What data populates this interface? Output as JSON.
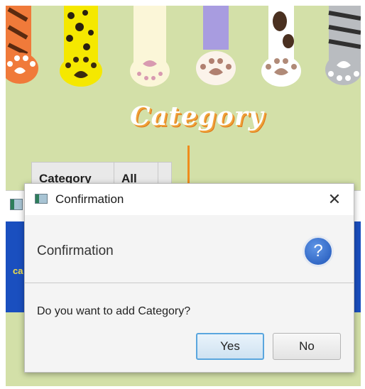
{
  "app": {
    "title": "Category",
    "table_headers": [
      "Category",
      "All"
    ],
    "band_text": "ca"
  },
  "dialog": {
    "window_title": "Confirmation",
    "close_glyph": "✕",
    "header_text": "Confirmation",
    "help_glyph": "?",
    "content_text": "Do you want to add Category?",
    "yes_label": "Yes",
    "no_label": "No"
  },
  "colors": {
    "background": "#d3e0a8",
    "accent_orange": "#ef8c1c",
    "band_blue": "#1a4fbf",
    "focus_blue": "#5aa6de"
  },
  "icons": [
    "cat-paws-banner",
    "window-icon",
    "close-icon",
    "help-icon"
  ]
}
